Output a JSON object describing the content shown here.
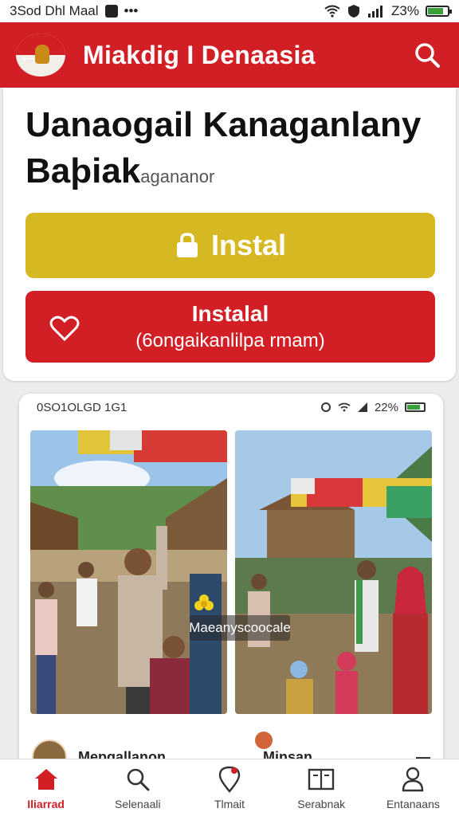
{
  "status_bar": {
    "time_text": "3Sod Dhl Maal",
    "battery_text": "Z3%"
  },
  "app_bar": {
    "title": "Miakdig I Denaasia",
    "back_icon": "back-arrow-icon",
    "search_icon": "search-icon"
  },
  "hero": {
    "title_line1": "Uanaogail Kanaganlany",
    "title_line2": "Baþiak",
    "title_small": "agananor"
  },
  "buttons": {
    "primary_label": "Instal",
    "primary_icon": "lock-icon",
    "secondary_label": "Instalal",
    "secondary_sublabel": "(6ongaikanlilpa rmam)",
    "secondary_icon": "heart-icon"
  },
  "card": {
    "status_left": "0SO1OLGD 1G1",
    "status_right": "22%",
    "overlay_label": "Maeanyscoocale",
    "left_author": "Mepgallanon",
    "right_author": "Minsan"
  },
  "bottom_nav": {
    "items": [
      {
        "label": "Iliarrad",
        "icon": "home-icon",
        "active": true
      },
      {
        "label": "Selenaali",
        "icon": "search-icon",
        "active": false
      },
      {
        "label": "Tlmait",
        "icon": "location-pin-icon",
        "active": false
      },
      {
        "label": "Serabnak",
        "icon": "book-icon",
        "active": false
      },
      {
        "label": "Entanaans",
        "icon": "person-icon",
        "active": false
      }
    ]
  },
  "colors": {
    "brand_red": "#d21f26",
    "brand_yellow": "#d6b823"
  }
}
